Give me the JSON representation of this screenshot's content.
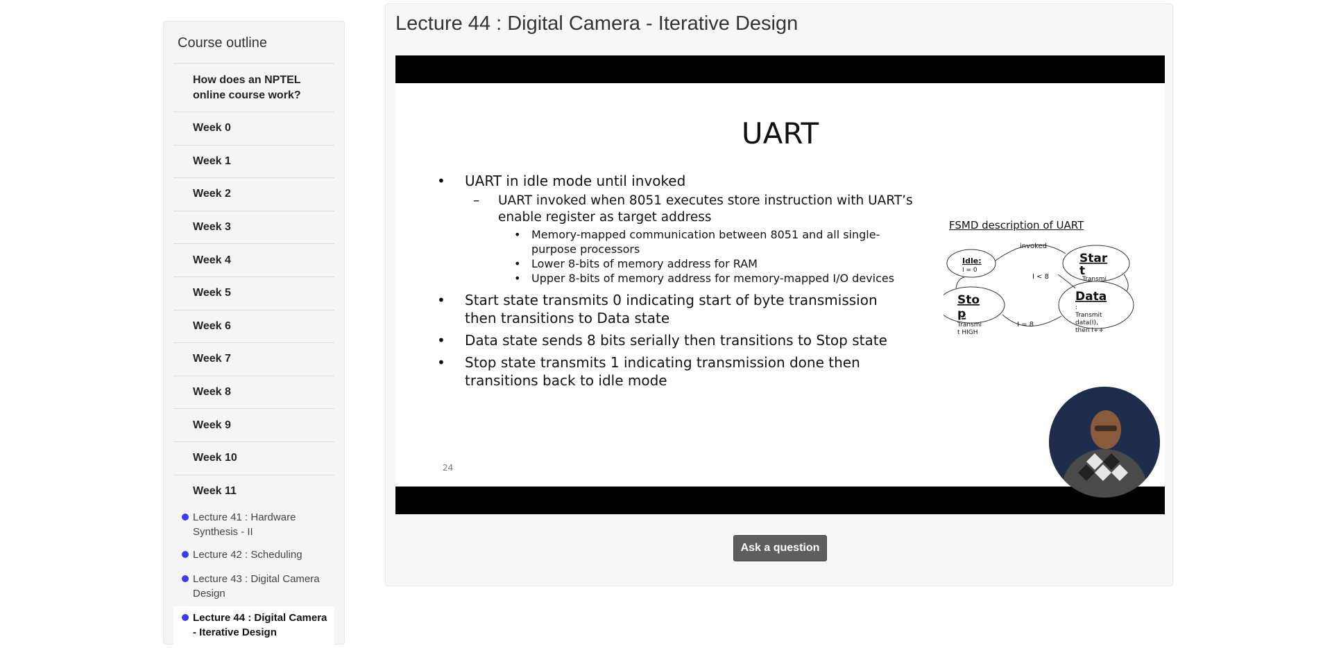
{
  "sidebar": {
    "title": "Course outline",
    "intro": "How does an NPTEL online course work?",
    "weeks": [
      "Week 0",
      "Week 1",
      "Week 2",
      "Week 3",
      "Week 4",
      "Week 5",
      "Week 6",
      "Week 7",
      "Week 8",
      "Week 9",
      "Week 10",
      "Week 11"
    ],
    "lessons": [
      {
        "label": "Lecture 41 : Hardware Synthesis - II"
      },
      {
        "label": "Lecture 42 : Scheduling"
      },
      {
        "label": "Lecture 43 : Digital Camera Design"
      },
      {
        "label": "Lecture 44 : Digital Camera - Iterative Design",
        "active": true
      }
    ]
  },
  "main": {
    "title": "Lecture 44 : Digital Camera - Iterative Design",
    "ask_button": "Ask a question"
  },
  "slide": {
    "title": "UART",
    "bullets": [
      {
        "level": 1,
        "text": "UART in idle mode until invoked"
      },
      {
        "level": 2,
        "text": "UART invoked when 8051 executes store instruction with UART’s enable register as target address"
      },
      {
        "level": 3,
        "text": "Memory-mapped communication between 8051 and all single-purpose processors"
      },
      {
        "level": 3,
        "text": "Lower 8-bits of memory address for RAM"
      },
      {
        "level": 3,
        "text": "Upper 8-bits of memory address for memory-mapped I/O devices"
      },
      {
        "level": 1,
        "text": "Start state transmits 0 indicating start of byte transmission then transitions to Data state"
      },
      {
        "level": 1,
        "text": "Data state sends 8 bits serially then transitions to Stop state"
      },
      {
        "level": 1,
        "text": "Stop state transmits 1 indicating transmission done then transitions back to idle mode"
      }
    ],
    "page_number": "24",
    "fsmd": {
      "title": "FSMD description of UART",
      "idle_label": "Idle:",
      "idle_action": "I = 0",
      "start_label": "Star",
      "start_label2": "t",
      "start_action": "Transmi",
      "data_label": "Data",
      "data_action_1": ":",
      "data_action_2": "Transmit",
      "data_action_3": "data(I),",
      "data_action_4": "then I++",
      "stop_label": "Sto",
      "stop_label2": "p",
      "stop_action_1": ":",
      "stop_action_2": "Transmi",
      "stop_action_3": "t HIGH",
      "edge_invoked": "invoked",
      "edge_lt8": "I < 8",
      "edge_eq8": "I = 8"
    }
  }
}
